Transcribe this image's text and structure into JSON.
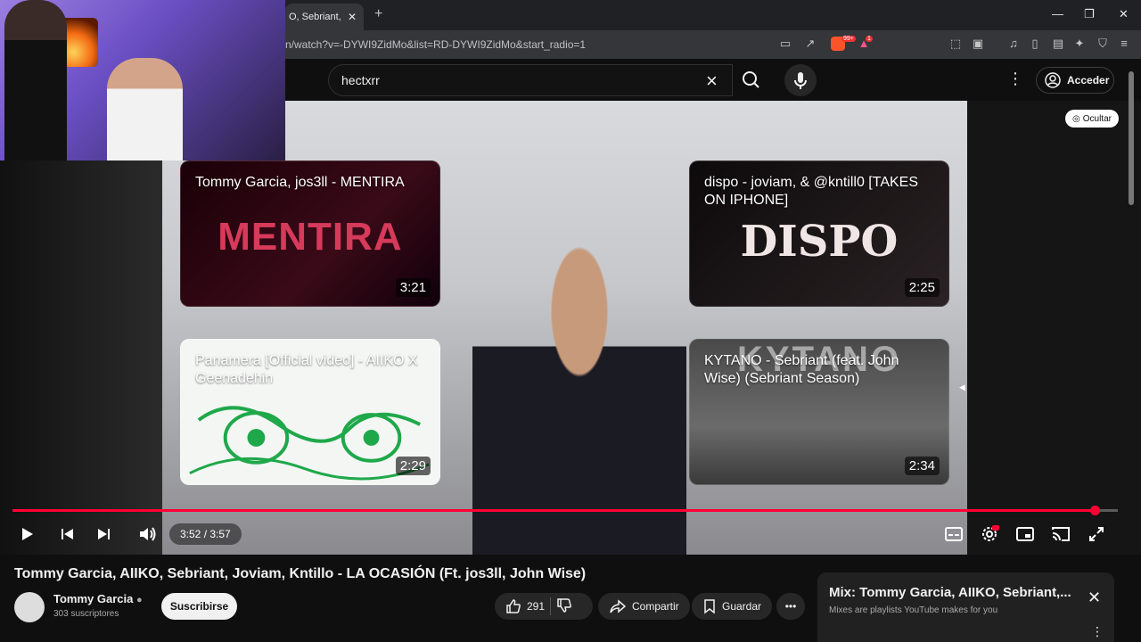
{
  "browser": {
    "tab_title": "O, Sebriant, J",
    "url": "n/watch?v=-DYWI9ZidMo&list=RD-DYWI9ZidMo&start_radio=1",
    "brave_badge": "99+",
    "alert_badge": "1"
  },
  "header": {
    "search_value": "hectxrr",
    "signin_label": "Acceder"
  },
  "player": {
    "hide_label": "Ocultar",
    "time": "3:52 / 3:57",
    "progress_fraction": 0.979,
    "end_cards": [
      {
        "title": "Tommy Garcia, jos3ll - MENTIRA",
        "art": "MENTIRA",
        "duration": "3:21"
      },
      {
        "title": "dispo - joviam, & @kntill0 [TAKES ON IPHONE]",
        "art": "DISPO",
        "duration": "2:25"
      },
      {
        "title": "Panamera [Official video] - AIIKO X Geenadehin",
        "art": "",
        "duration": "2:29"
      },
      {
        "title": "KYTANO - Sebriant (feat. John Wise) (Sebriant Season)",
        "art": "KYTANO",
        "duration": "2:34"
      }
    ]
  },
  "video": {
    "title": "Tommy Garcia, AIIKO, Sebriant, Joviam, Kntillo - LA OCASIÓN (Ft. jos3ll, John Wise)",
    "channel": "Tommy Garcia",
    "subscribers": "303 suscriptores",
    "subscribe_label": "Suscribirse",
    "likes": "291",
    "share_label": "Compartir",
    "save_label": "Guardar"
  },
  "mix": {
    "title": "Mix: Tommy Garcia, AIIKO, Sebriant,...",
    "subtitle": "Mixes are playlists YouTube makes for you"
  },
  "colors": {
    "accent": "#ff0033",
    "background": "#0f0f0f"
  }
}
